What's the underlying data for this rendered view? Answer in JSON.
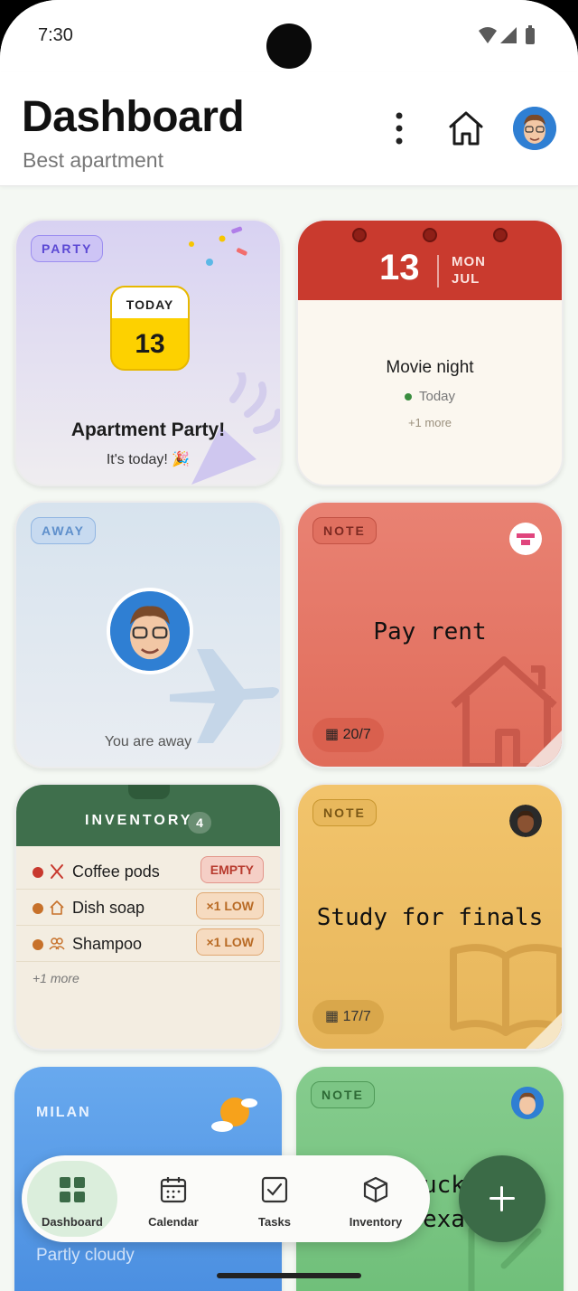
{
  "status": {
    "time": "7:30"
  },
  "header": {
    "title": "Dashboard",
    "subtitle": "Best apartment"
  },
  "party": {
    "badge": "PARTY",
    "cal_label": "TODAY",
    "cal_day": "13",
    "title": "Apartment Party!",
    "subtitle": "It's today! 🎉"
  },
  "movie": {
    "day": "13",
    "dow": "MON",
    "month": "JUL",
    "title": "Movie night",
    "when": "Today",
    "more": "+1 more"
  },
  "away": {
    "badge": "AWAY",
    "text": "You are away"
  },
  "rent": {
    "badge": "NOTE",
    "text": "Pay rent",
    "date": "20/7"
  },
  "inventory": {
    "title": "INVENTORY",
    "count": "4",
    "items": [
      {
        "name": "Coffee pods",
        "tag": "EMPTY",
        "dot": "#c8392e"
      },
      {
        "name": "Dish soap",
        "tag": "×1 LOW",
        "dot": "#c7712a"
      },
      {
        "name": "Shampoo",
        "tag": "×1 LOW",
        "dot": "#c7712a"
      }
    ],
    "more": "+1 more"
  },
  "study": {
    "badge": "NOTE",
    "text": "Study for finals",
    "date": "17/7"
  },
  "weather": {
    "city": "MILAN",
    "condition": "Partly cloudy"
  },
  "green": {
    "badge": "NOTE",
    "text_line1": "uck",
    "text_line2": "exa"
  },
  "nav": {
    "items": [
      "Dashboard",
      "Calendar",
      "Tasks",
      "Inventory"
    ],
    "active": "Dashboard"
  },
  "colors": {
    "accent": "#3b6b47",
    "nav_active": "#dbeedc"
  }
}
